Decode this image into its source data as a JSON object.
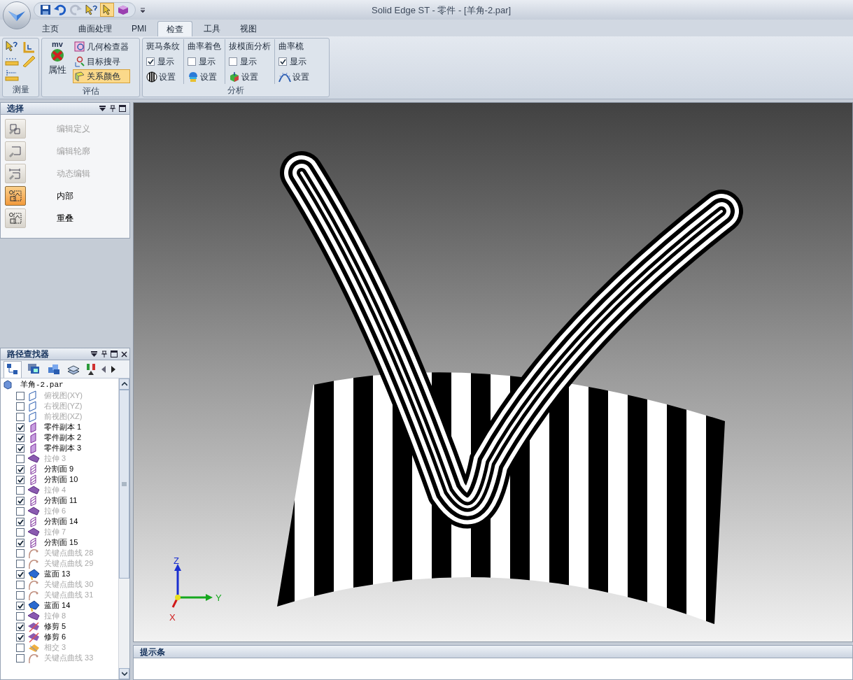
{
  "window": {
    "title": "Solid Edge ST - 零件 - [羊角-2.par]"
  },
  "tabs": [
    {
      "label": "主页",
      "selected": false
    },
    {
      "label": "曲面处理",
      "selected": false
    },
    {
      "label": "PMI",
      "selected": false
    },
    {
      "label": "检查",
      "selected": true
    },
    {
      "label": "工具",
      "selected": false
    },
    {
      "label": "视图",
      "selected": false
    }
  ],
  "ribbon": {
    "measure_group": {
      "label": "测量"
    },
    "evaluate_group": {
      "label": "评估",
      "big_button": "属性",
      "big_button_top": "mv",
      "buttons": [
        {
          "label": "几何检查器",
          "selected": false
        },
        {
          "label": "目标搜寻",
          "selected": false
        },
        {
          "label": "关系颜色",
          "selected": true
        }
      ]
    },
    "analysis_group": {
      "label": "分析",
      "sections": [
        {
          "title": "斑马条纹",
          "show_label": "显示",
          "checked": true,
          "settings_label": "设置",
          "kind": "zebra"
        },
        {
          "title": "曲率着色",
          "show_label": "显示",
          "checked": false,
          "settings_label": "设置",
          "kind": "curvature"
        },
        {
          "title": "拔模面分析",
          "show_label": "显示",
          "checked": false,
          "settings_label": "设置",
          "kind": "draft"
        },
        {
          "title": "曲率梳",
          "show_label": "显示",
          "checked": true,
          "settings_label": "设置",
          "kind": "comb"
        }
      ]
    }
  },
  "select_panel": {
    "title": "选择",
    "items": [
      {
        "label": "编辑定义",
        "disabled": true,
        "selected": false
      },
      {
        "label": "编辑轮廓",
        "disabled": true,
        "selected": false
      },
      {
        "label": "动态编辑",
        "disabled": true,
        "selected": false
      },
      {
        "label": "内部",
        "disabled": false,
        "selected": true
      },
      {
        "label": "重叠",
        "disabled": false,
        "selected": false
      }
    ]
  },
  "pathfinder": {
    "title": "路径查找器",
    "root": "羊角-2.par",
    "items": [
      {
        "label": "俯视图(XY)",
        "checked": false,
        "kind": "plane"
      },
      {
        "label": "右视图(YZ)",
        "checked": false,
        "kind": "plane"
      },
      {
        "label": "前视图(XZ)",
        "checked": false,
        "kind": "plane"
      },
      {
        "label": "零件副本 1",
        "checked": true,
        "kind": "copy"
      },
      {
        "label": "零件副本 2",
        "checked": true,
        "kind": "copy"
      },
      {
        "label": "零件副本 3",
        "checked": true,
        "kind": "copy"
      },
      {
        "label": "拉伸 3",
        "checked": false,
        "kind": "extrude"
      },
      {
        "label": "分割面 9",
        "checked": true,
        "kind": "split"
      },
      {
        "label": "分割面 10",
        "checked": true,
        "kind": "split"
      },
      {
        "label": "拉伸 4",
        "checked": false,
        "kind": "extrude"
      },
      {
        "label": "分割面 11",
        "checked": true,
        "kind": "split"
      },
      {
        "label": "拉伸 6",
        "checked": false,
        "kind": "extrude"
      },
      {
        "label": "分割面 14",
        "checked": true,
        "kind": "split"
      },
      {
        "label": "拉伸 7",
        "checked": false,
        "kind": "extrude"
      },
      {
        "label": "分割面 15",
        "checked": true,
        "kind": "split"
      },
      {
        "label": "关键点曲线 28",
        "checked": false,
        "kind": "curve"
      },
      {
        "label": "关键点曲线 29",
        "checked": false,
        "kind": "curve"
      },
      {
        "label": "蓝面 13",
        "checked": true,
        "kind": "bluesurf"
      },
      {
        "label": "关键点曲线 30",
        "checked": false,
        "kind": "curve"
      },
      {
        "label": "关键点曲线 31",
        "checked": false,
        "kind": "curve"
      },
      {
        "label": "蓝面 14",
        "checked": true,
        "kind": "bluesurf"
      },
      {
        "label": "拉伸 8",
        "checked": false,
        "kind": "extrude"
      },
      {
        "label": "修剪 5",
        "checked": true,
        "kind": "trim"
      },
      {
        "label": "修剪 6",
        "checked": true,
        "kind": "trim"
      },
      {
        "label": "相交 3",
        "checked": false,
        "kind": "intersect"
      },
      {
        "label": "关键点曲线 33",
        "checked": false,
        "kind": "curve"
      }
    ]
  },
  "viewport": {
    "axes": [
      "Z",
      "Y",
      "X"
    ]
  },
  "prompt_bar": {
    "title": "提示条"
  }
}
